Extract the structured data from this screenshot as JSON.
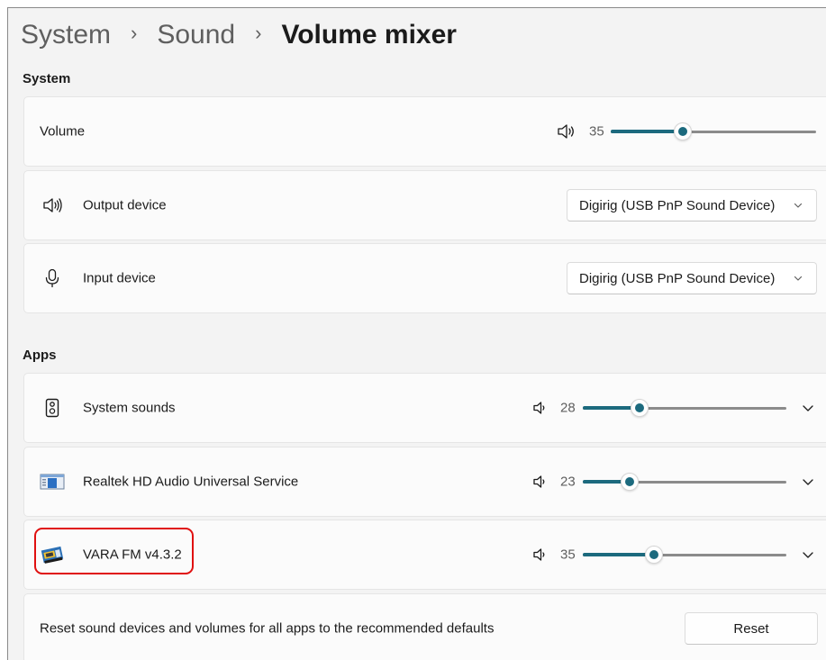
{
  "breadcrumb": {
    "items": [
      "System",
      "Sound"
    ],
    "current": "Volume mixer",
    "separator": "›"
  },
  "sections": {
    "system": "System",
    "apps": "Apps"
  },
  "system": {
    "volume": {
      "label": "Volume",
      "value": "35",
      "level": 0.35
    },
    "output": {
      "label": "Output device",
      "selected": "Digirig (USB PnP Sound Device)"
    },
    "input": {
      "label": "Input device",
      "selected": "Digirig (USB PnP Sound Device)"
    }
  },
  "apps": [
    {
      "name": "System sounds",
      "value": "28",
      "level": 0.28,
      "icon": "speaker-device-icon"
    },
    {
      "name": "Realtek HD Audio Universal Service",
      "value": "23",
      "level": 0.23,
      "icon": "realtek-app-icon"
    },
    {
      "name": "VARA FM v4.3.2",
      "value": "35",
      "level": 0.35,
      "icon": "vara-app-icon"
    }
  ],
  "reset": {
    "description": "Reset sound devices and volumes for all apps to the recommended defaults",
    "button": "Reset"
  },
  "colors": {
    "accent": "#1c6a7e",
    "highlight": "#e01010",
    "card": "#fbfbfb",
    "background": "#f3f3f3"
  }
}
